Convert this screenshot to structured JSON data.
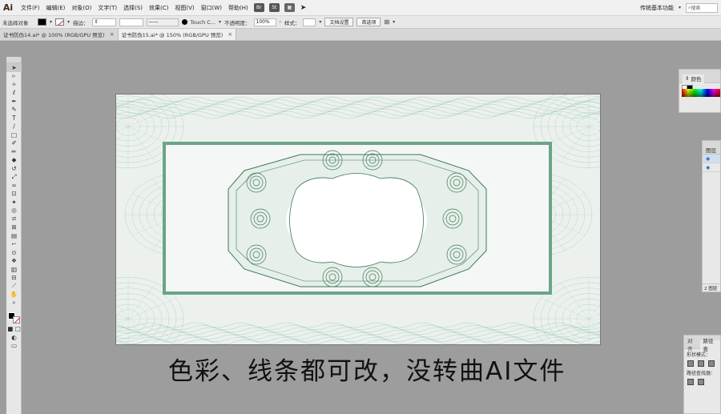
{
  "app": {
    "logo": "Ai"
  },
  "menubar": {
    "items": [
      "文件(F)",
      "编辑(E)",
      "对象(O)",
      "文字(T)",
      "选择(S)",
      "效果(C)",
      "视图(V)",
      "窗口(W)",
      "帮助(H)"
    ],
    "icon_br": "Br",
    "icon_st": "St",
    "workspace": "传统基本功能",
    "search_placeholder": "搜索"
  },
  "controlbar": {
    "selection_status": "未选择对象",
    "stroke_label": "描边：",
    "brush_name": "Touch C...",
    "opacity_label": "不透明度：",
    "opacity_value": "100%",
    "style_label": "样式：",
    "doc_setup_button": "文档设置",
    "preferences_button": "首选项"
  },
  "tabs": [
    {
      "label": "证书防伪14.ai* @ 100% (RGB/GPU 预览)",
      "close": "×"
    },
    {
      "label": "证书防伪15.ai* @ 150% (RGB/GPU 预览)",
      "close": "×"
    }
  ],
  "toolbar": {
    "tools": [
      "selection-tool",
      "direct-selection-tool",
      "magic-wand-tool",
      "lasso-tool",
      "pen-tool",
      "curvature-tool",
      "type-tool",
      "line-tool",
      "rectangle-tool",
      "paintbrush-tool",
      "shaper-tool",
      "eraser-tool",
      "rotate-tool",
      "scale-tool",
      "width-tool",
      "free-transform-tool",
      "puppet-warp-tool",
      "shape-builder-tool",
      "perspective-grid-tool",
      "mesh-tool",
      "gradient-tool",
      "eyedropper-tool",
      "blend-tool",
      "symbol-sprayer-tool",
      "column-graph-tool",
      "artboard-tool",
      "slice-tool",
      "hand-tool",
      "zoom-tool"
    ]
  },
  "caption": "色彩、线条都可改，没转曲AI文件",
  "panels": {
    "color": {
      "title": "颜色",
      "collapse": "»"
    },
    "layers": {
      "title": "图层",
      "footer": "2 图层"
    },
    "pathfinder": {
      "tab_align": "对齐",
      "tab_pathfinder": "路径查",
      "shape_modes": "形状模式：",
      "pathfinders": "路径查找器："
    }
  },
  "colors": {
    "frame_green": "#6aa585",
    "guilloche": "#9ccab2",
    "ornament": "#3d7a5a"
  }
}
